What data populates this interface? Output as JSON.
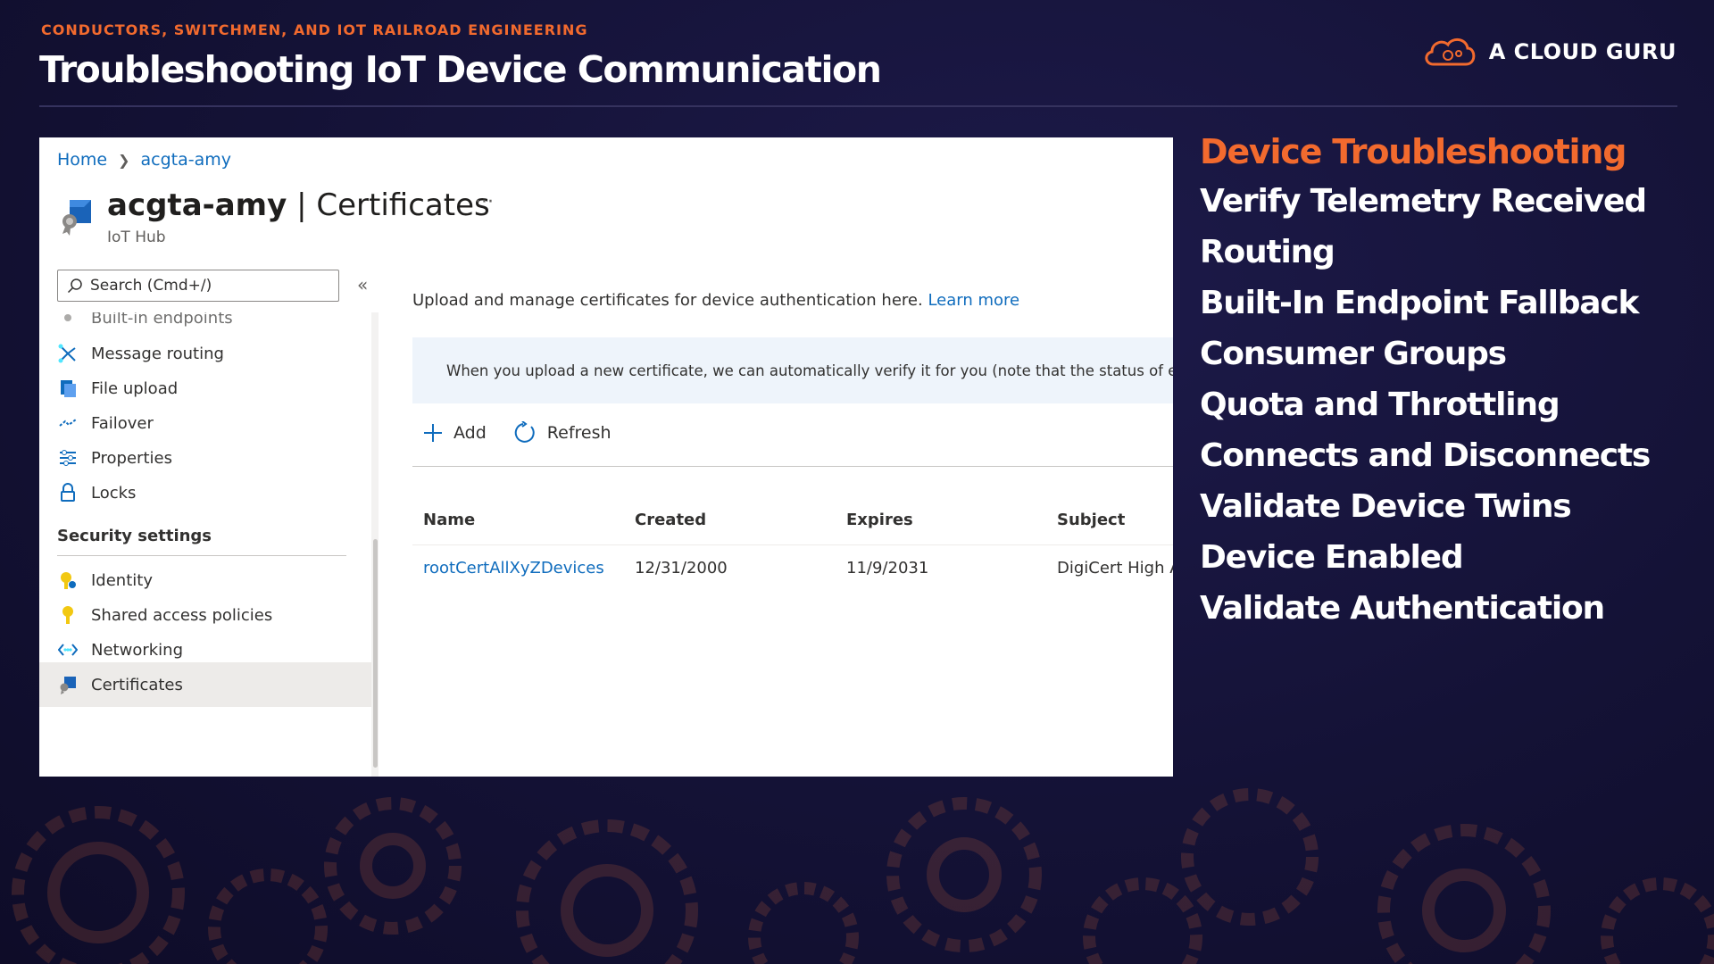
{
  "header": {
    "kicker": "CONDUCTORS, SWITCHMEN, AND IOT RAILROAD ENGINEERING",
    "title": "Troubleshooting IoT Device Communication",
    "brand": "A CLOUD GURU"
  },
  "colors": {
    "accent": "#f26a2e",
    "background": "#141236",
    "link": "#0f6cbd"
  },
  "portal": {
    "breadcrumb": [
      "Home",
      "acgta-amy"
    ],
    "resource_name": "acgta-amy",
    "blade_title": "Certificates",
    "title_separator": "|",
    "resource_type": "IoT Hub",
    "more": "···",
    "search_placeholder": "Search (Cmd+/)",
    "collapse": "«",
    "nav_cut": "Built-in endpoints",
    "nav_items": [
      {
        "label": "Message routing",
        "icon": "routing-icon"
      },
      {
        "label": "File upload",
        "icon": "file-upload-icon"
      },
      {
        "label": "Failover",
        "icon": "failover-icon"
      },
      {
        "label": "Properties",
        "icon": "properties-icon"
      },
      {
        "label": "Locks",
        "icon": "lock-icon"
      }
    ],
    "security_section": "Security settings",
    "security_items": [
      {
        "label": "Identity",
        "icon": "identity-icon"
      },
      {
        "label": "Shared access policies",
        "icon": "key-icon"
      },
      {
        "label": "Networking",
        "icon": "networking-icon"
      },
      {
        "label": "Certificates",
        "icon": "certificate-icon",
        "selected": true
      }
    ],
    "description": "Upload and manage certificates for device authentication here.",
    "learn_more": "Learn more",
    "info_message": "When you upload a new certificate, we can automatically verify it for you (note that the status of exis",
    "toolbar": {
      "add": "Add",
      "refresh": "Refresh"
    },
    "table": {
      "columns": [
        "Name",
        "Created",
        "Expires",
        "Subject"
      ],
      "rows": [
        [
          "rootCertAllXyZDevices",
          "12/31/2000",
          "11/9/2031",
          "DigiCert High A"
        ]
      ]
    }
  },
  "topics": [
    "Device Troubleshooting",
    "Verify Telemetry Received",
    "Routing",
    "Built-In Endpoint Fallback",
    "Consumer Groups",
    "Quota and Throttling",
    "Connects and Disconnects",
    "Validate Device Twins",
    "Device Enabled",
    "Validate Authentication"
  ]
}
